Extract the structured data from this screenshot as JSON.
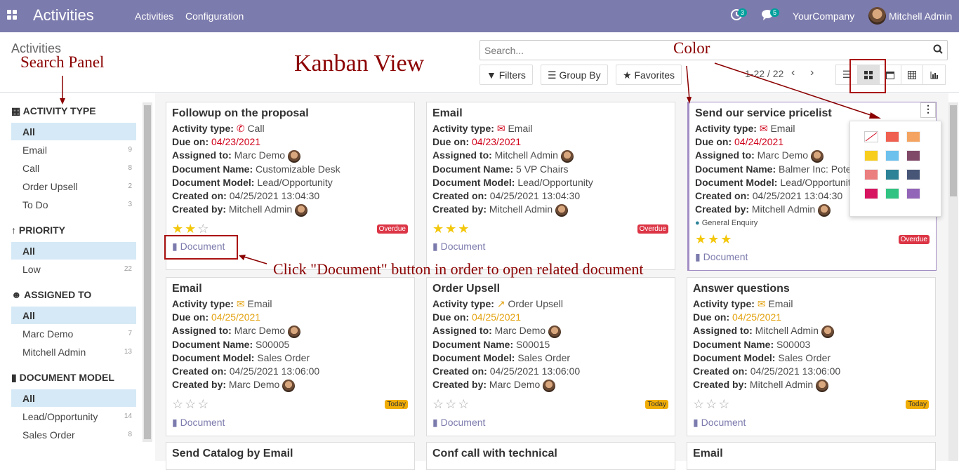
{
  "app": {
    "title": "Activities"
  },
  "menu": {
    "activities": "Activities",
    "configuration": "Configuration"
  },
  "systray": {
    "activity_count": "3",
    "message_count": "5",
    "company": "YourCompany",
    "user": "Mitchell Admin"
  },
  "breadcrumb": "Activities",
  "search": {
    "placeholder": "Search..."
  },
  "filters": {
    "filters": "Filters",
    "group_by": "Group By",
    "favorites": "Favorites"
  },
  "pager": {
    "text": "1-22 / 22"
  },
  "sidebar": {
    "sections": [
      {
        "title": "ACTIVITY TYPE",
        "items": [
          {
            "label": "All",
            "count": ""
          },
          {
            "label": "Email",
            "count": "9"
          },
          {
            "label": "Call",
            "count": "8"
          },
          {
            "label": "Order Upsell",
            "count": "2"
          },
          {
            "label": "To Do",
            "count": "3"
          }
        ]
      },
      {
        "title": "PRIORITY",
        "items": [
          {
            "label": "All",
            "count": ""
          },
          {
            "label": "Low",
            "count": "22"
          }
        ]
      },
      {
        "title": "ASSIGNED TO",
        "items": [
          {
            "label": "All",
            "count": ""
          },
          {
            "label": "Marc Demo",
            "count": "7"
          },
          {
            "label": "Mitchell Admin",
            "count": "13"
          }
        ]
      },
      {
        "title": "DOCUMENT MODEL",
        "items": [
          {
            "label": "All",
            "count": ""
          },
          {
            "label": "Lead/Opportunity",
            "count": "14"
          },
          {
            "label": "Sales Order",
            "count": "8"
          }
        ]
      }
    ]
  },
  "labels": {
    "activity_type": "Activity type:",
    "due_on": "Due on:",
    "assigned_to": "Assigned to:",
    "document_name": "Document Name:",
    "document_model": "Document Model:",
    "created_on": "Created on:",
    "created_by": "Created by:",
    "document_button": "Document"
  },
  "cards": [
    {
      "title": "Followup on the proposal",
      "type": "Call",
      "due": "04/23/2021",
      "assigned": "Marc Demo",
      "doc_name": "Customizable Desk",
      "model": "Lead/Opportunity",
      "created_on": "04/25/2021 13:04:30",
      "created_by": "Mitchell Admin",
      "stars": 2,
      "status": "Overdue"
    },
    {
      "title": "Email",
      "type": "Email",
      "due": "04/23/2021",
      "assigned": "Mitchell Admin",
      "doc_name": "5 VP Chairs",
      "model": "Lead/Opportunity",
      "created_on": "04/25/2021 13:04:30",
      "created_by": "Mitchell Admin",
      "stars": 3,
      "status": "Overdue"
    },
    {
      "title": "Send our service pricelist",
      "type": "Email",
      "due": "04/24/2021",
      "assigned": "Marc Demo",
      "doc_name": "Balmer Inc: Potentia",
      "model": "Lead/Opportunity",
      "created_on": "04/25/2021 13:04:30",
      "created_by": "Mitchell Admin",
      "tag": "General Enquiry",
      "stars": 3,
      "status": "Overdue"
    },
    {
      "title": "Email",
      "type": "Email",
      "due": "04/25/2021",
      "assigned": "Marc Demo",
      "doc_name": "S00005",
      "model": "Sales Order",
      "created_on": "04/25/2021 13:06:00",
      "created_by": "Marc Demo",
      "stars": 0,
      "status": "Today"
    },
    {
      "title": "Order Upsell",
      "type": "Order Upsell",
      "due": "04/25/2021",
      "assigned": "Marc Demo",
      "doc_name": "S00015",
      "model": "Sales Order",
      "created_on": "04/25/2021 13:06:00",
      "created_by": "Marc Demo",
      "stars": 0,
      "status": "Today"
    },
    {
      "title": "Answer questions",
      "type": "Email",
      "due": "04/25/2021",
      "assigned": "Mitchell Admin",
      "doc_name": "S00003",
      "model": "Sales Order",
      "created_on": "04/25/2021 13:06:00",
      "created_by": "Mitchell Admin",
      "stars": 0,
      "status": "Today"
    },
    {
      "title": "Send Catalog by Email"
    },
    {
      "title": "Conf call with technical"
    },
    {
      "title": "Email"
    }
  ],
  "color_palette": [
    "#ffffff",
    "#f06050",
    "#f4a460",
    "#f7cd1f",
    "#6cc1ed",
    "#814968",
    "#eb7e7f",
    "#2c8397",
    "#475577",
    "#d6145f",
    "#30c381",
    "#9365b8"
  ],
  "annotations": {
    "search_panel": "Search Panel",
    "kanban_view": "Kanban View",
    "color": "Color",
    "document_hint": "Click \"Document\" button in order to open related document"
  }
}
